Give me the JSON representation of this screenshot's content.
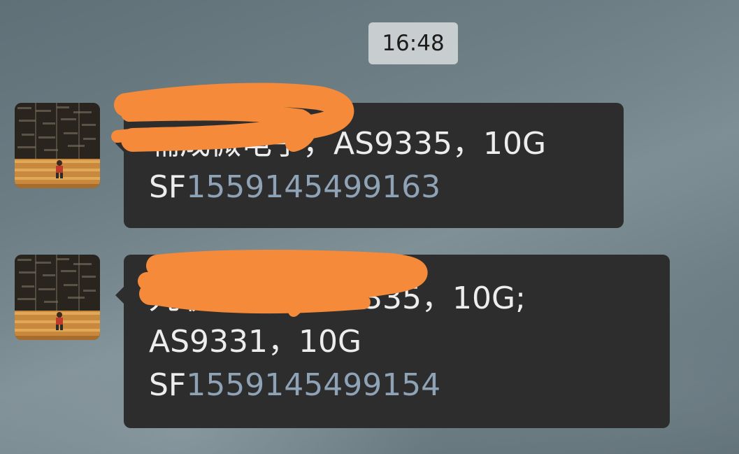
{
  "chat": {
    "timestamp": "16:48",
    "messages": [
      {
        "line1": "辅成微电子，AS9335，10G",
        "tracking_prefix": "SF",
        "tracking_number": "1559145499163"
      },
      {
        "line1": "九联科技，AS9335，10G;",
        "line2": "AS9331，10G",
        "tracking_prefix": "SF",
        "tracking_number": "1559145499154"
      }
    ]
  },
  "colors": {
    "bubble": "#2d2d2d",
    "text": "#ededed",
    "link": "#8fa3b6",
    "redaction": "#f58a3a",
    "timestamp_bg": "#c8cdcf"
  },
  "icons": [
    "user-avatar",
    "redaction-scribble"
  ]
}
